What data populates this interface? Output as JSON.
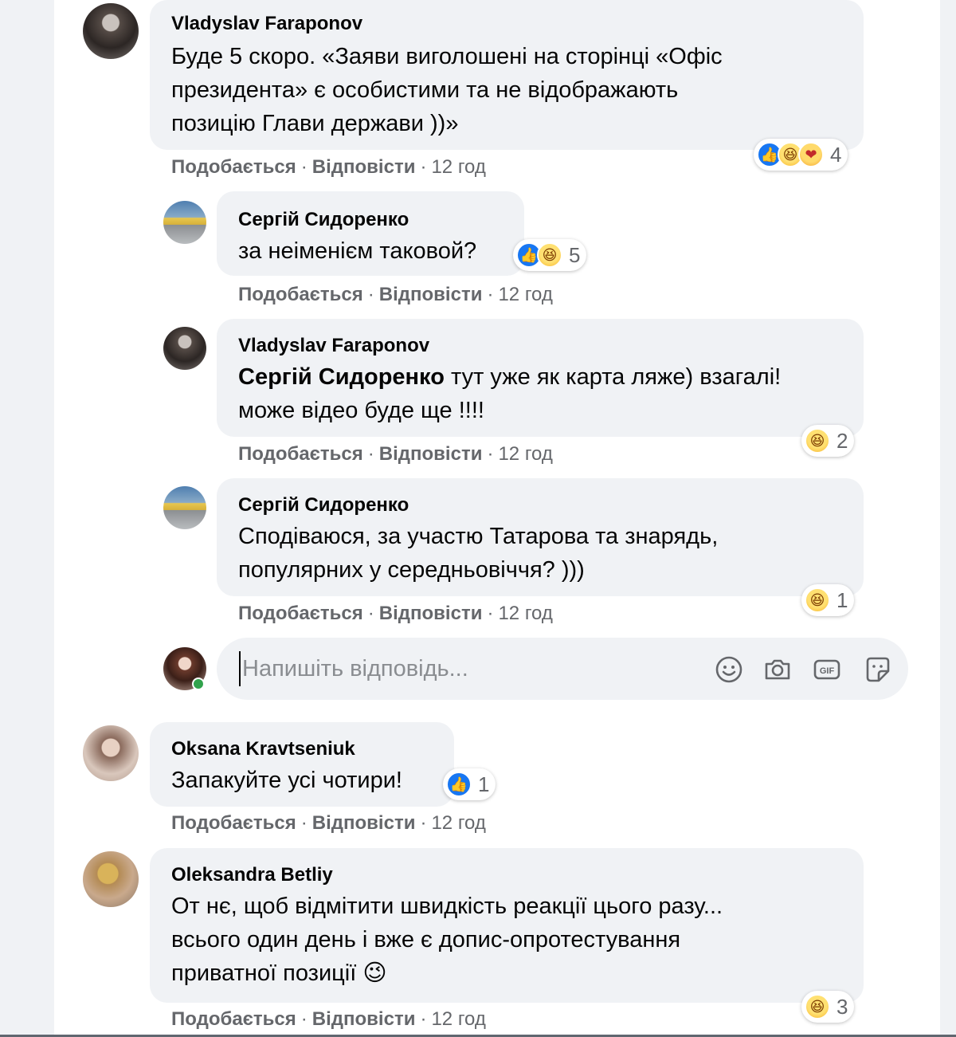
{
  "actions": {
    "like": "Подобається",
    "reply": "Відповісти",
    "separator": "·"
  },
  "comments": [
    {
      "author": "Vladyslav Faraponov",
      "lines": [
        "Буде 5 скоро. «Заяви виголошені на сторінці «Офіс",
        "президента» є особистими та не відображають",
        "позицію Глави держави ))»"
      ],
      "time": "12 год",
      "reactions": [
        "like",
        "haha",
        "care"
      ],
      "reaction_count": "4"
    },
    {
      "author": "Сергій Сидоренко",
      "lines": [
        "за неіменієм таковой?"
      ],
      "time": "12 год",
      "reactions": [
        "like",
        "haha"
      ],
      "reaction_count": "5"
    },
    {
      "author": "Vladyslav Faraponov",
      "mention": "Сергій Сидоренко",
      "line1_rest": " тут уже як карта ляже) взагалі!",
      "line2": "може відео буде ще !!!!",
      "time": "12 год",
      "reactions": [
        "haha"
      ],
      "reaction_count": "2"
    },
    {
      "author": "Сергій Сидоренко",
      "lines": [
        "Сподіваюся, за участю Татарова та знарядь,",
        "популярних у середньовіччя? )))"
      ],
      "time": "12 год",
      "reactions": [
        "haha"
      ],
      "reaction_count": "1"
    },
    {
      "author": "Oksana Kravtseniuk",
      "lines": [
        "Запакуйте усі чотири!"
      ],
      "time": "12 год",
      "reactions": [
        "like"
      ],
      "reaction_count": "1"
    },
    {
      "author": "Oleksandra Betliy",
      "lines": [
        "От нє, щоб відмітити швидкість реакції цього разу...",
        "всього один день і вже є допис-опротестування",
        "приватної позиції"
      ],
      "emoji": "😉",
      "time": "12 год",
      "reactions": [
        "haha"
      ],
      "reaction_count": "3"
    }
  ],
  "reply_box": {
    "placeholder": "Напишіть відповідь...",
    "tools": [
      "emoji-icon",
      "camera-icon",
      "gif-icon",
      "sticker-icon"
    ]
  },
  "colors": {
    "bubble": "#f0f2f5",
    "meta": "#65676b",
    "like": "#1877f2",
    "online": "#31a24c"
  }
}
